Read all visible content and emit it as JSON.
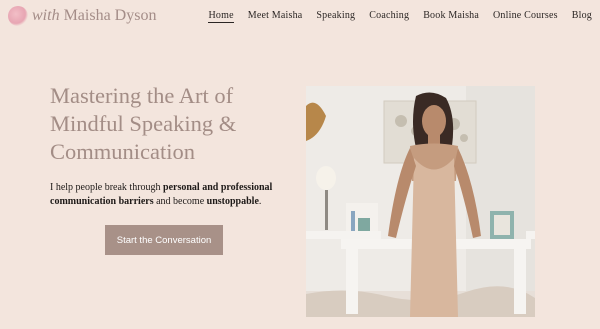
{
  "logo": {
    "with": "with",
    "name": "Maisha Dyson"
  },
  "nav": [
    {
      "label": "Home",
      "active": true
    },
    {
      "label": "Meet Maisha"
    },
    {
      "label": "Speaking"
    },
    {
      "label": "Coaching"
    },
    {
      "label": "Book Maisha"
    },
    {
      "label": "Online Courses"
    },
    {
      "label": "Blog"
    }
  ],
  "hero": {
    "headline": "Mastering the Art of Mindful Speaking & Communication",
    "lead_pre": "I help people break through ",
    "lead_bold1": "personal and professional communication barriers",
    "lead_mid": " and become ",
    "lead_bold2": "unstoppable",
    "lead_post": ".",
    "cta_label": "Start the Conversation"
  },
  "colors": {
    "background": "#f3e5dd",
    "accent": "#a38d86",
    "button": "#a89188"
  }
}
